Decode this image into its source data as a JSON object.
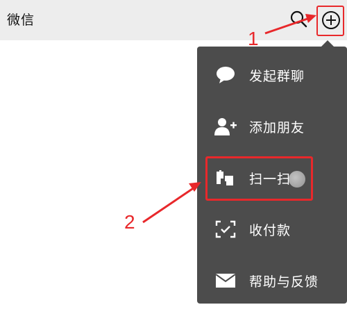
{
  "header": {
    "title": "微信",
    "search_icon": "search-icon",
    "add_icon": "plus-circle-icon"
  },
  "menu": {
    "items": [
      {
        "label": "发起群聊",
        "icon": "chat-bubble-icon"
      },
      {
        "label": "添加朋友",
        "icon": "add-friend-icon"
      },
      {
        "label": "扫一扫",
        "icon": "scan-icon"
      },
      {
        "label": "收付款",
        "icon": "payment-scan-icon"
      },
      {
        "label": "帮助与反馈",
        "icon": "mail-icon"
      }
    ]
  },
  "annotations": {
    "step_1": "1",
    "step_2": "2",
    "color": "#e8282b"
  },
  "colors": {
    "topbar_bg": "#ededed",
    "menu_bg": "#4c4c4c"
  }
}
